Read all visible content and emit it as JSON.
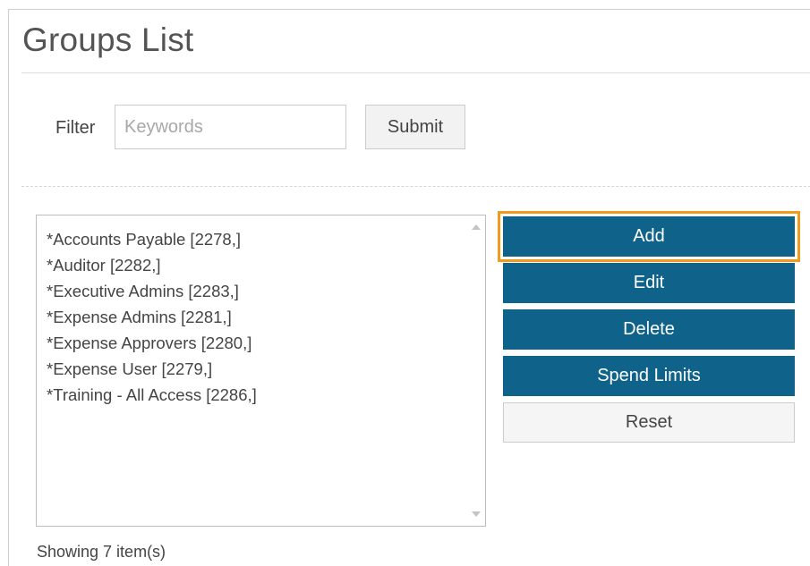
{
  "page": {
    "title": "Groups List"
  },
  "filter": {
    "label": "Filter",
    "placeholder": "Keywords",
    "value": "",
    "submit_label": "Submit"
  },
  "groups": {
    "items": [
      "*Accounts Payable [2278,]",
      "*Auditor [2282,]",
      "*Executive Admins [2283,]",
      "*Expense Admins [2281,]",
      "*Expense Approvers [2280,]",
      "*Expense User [2279,]",
      "*Training - All Access [2286,]"
    ],
    "status": "Showing 7 item(s)"
  },
  "actions": {
    "add_label": "Add",
    "edit_label": "Edit",
    "delete_label": "Delete",
    "spend_limits_label": "Spend Limits",
    "reset_label": "Reset"
  },
  "colors": {
    "primary_button": "#0f6289",
    "highlight_outline": "#f29a1c",
    "text": "#444444"
  }
}
